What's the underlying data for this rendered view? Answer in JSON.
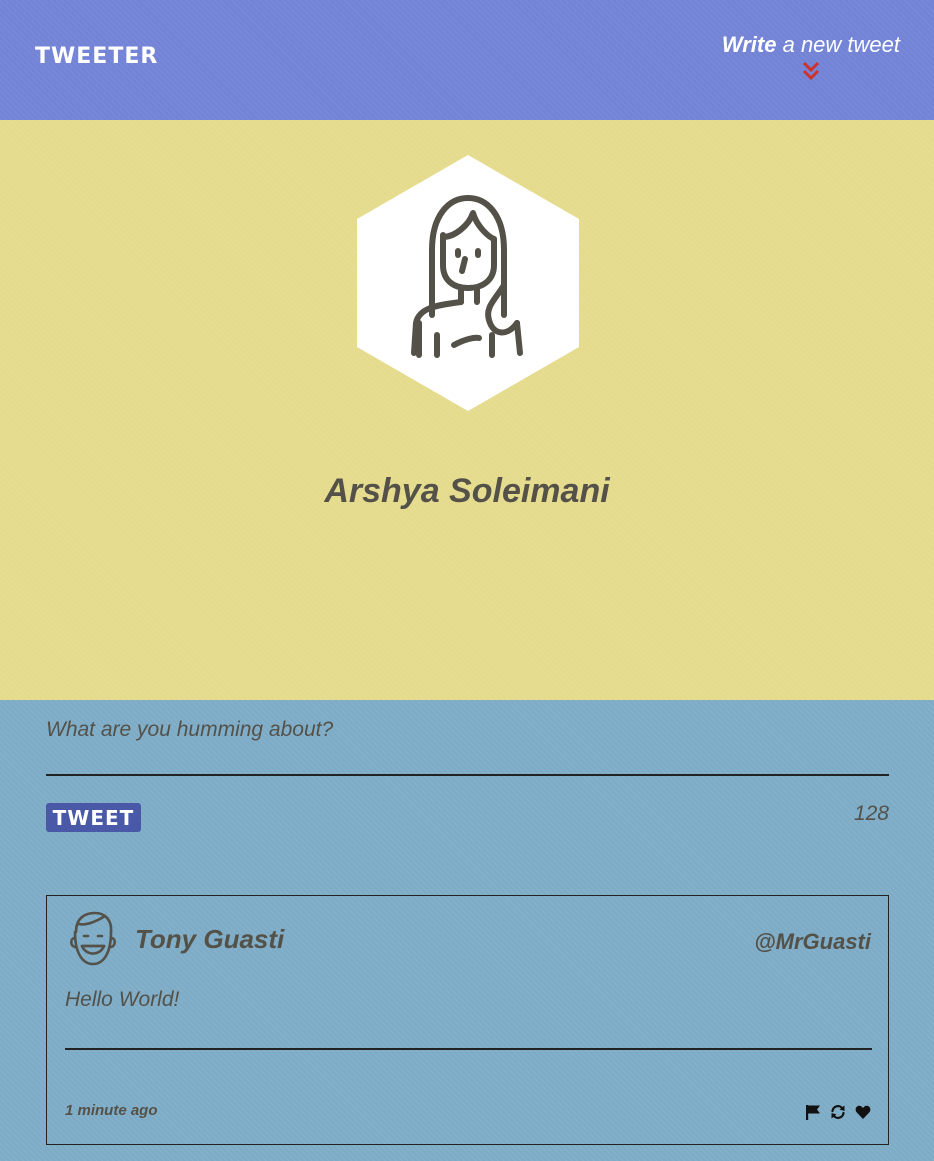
{
  "nav": {
    "brand": "TWEETER",
    "compose_bold": "Write",
    "compose_rest": " a new tweet",
    "compose_icon": "double-chevron-down-icon",
    "accent": "#d0312d"
  },
  "profile": {
    "name": "Arshya Soleimani",
    "avatar_icon": "woman-avatar-icon"
  },
  "composer": {
    "placeholder": "What are you humming about?",
    "value": "",
    "button_label": "TWEET",
    "counter": "128"
  },
  "tweets": [
    {
      "author": "Tony Guasti",
      "handle": "@MrGuasti",
      "avatar_icon": "smiling-man-avatar-icon",
      "content": "Hello World!",
      "timestamp": "1 minute ago",
      "actions": [
        "flag-icon",
        "retweet-icon",
        "heart-icon"
      ]
    }
  ],
  "colors": {
    "nav_bg": "#7383d6",
    "profile_bg": "#e5db8d",
    "main_bg": "#7eacc7",
    "button_bg": "#4a58a8",
    "text": "#545149"
  }
}
